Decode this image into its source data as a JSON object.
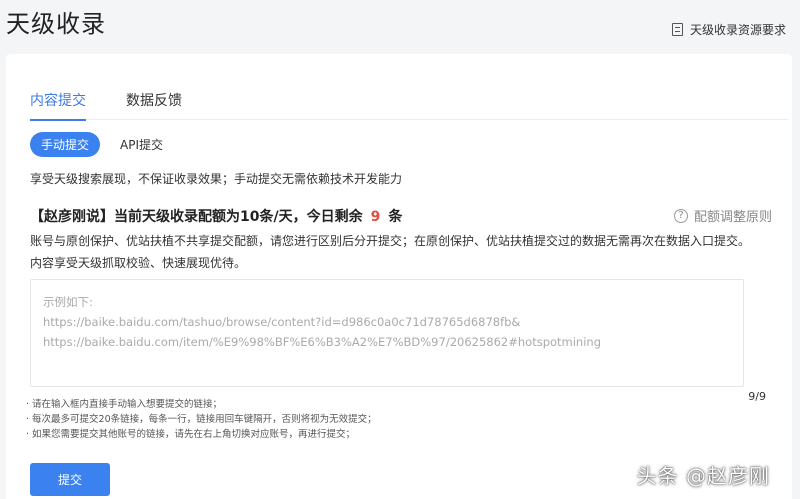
{
  "header": {
    "title": "天级收录",
    "resource_link": "天级收录资源要求"
  },
  "tabs": [
    {
      "label": "内容提交",
      "active": true
    },
    {
      "label": "数据反馈",
      "active": false
    }
  ],
  "mode": {
    "manual_label": "手动提交",
    "api_label": "API提交"
  },
  "description": "享受天级搜索展现，不保证收录效果；手动提交无需依赖技术开发能力",
  "quota": {
    "text": "【赵彦刚说】当前天级收录配额为10条/天，今日剩余",
    "remaining": "9",
    "unit": "条",
    "rule_link": "配额调整原则"
  },
  "info_line1": "账号与原创保护、优站扶植不共享提交配额，请您进行区别后分开提交；在原创保护、优站扶植提交过的数据无需再次在数据入口提交。",
  "info_line2": "内容享受天级抓取校验、快速展现优待。",
  "url_input": {
    "placeholder_title": "示例如下:",
    "example1": "https://baike.baidu.com/tashuo/browse/content?id=d986c0a0c71d78765d6878fb&",
    "example2": "https://baike.baidu.com/item/%E9%98%BF%E6%B3%A2%E7%BD%97/20625862#hotspotmining"
  },
  "counter": "9/9",
  "rules": [
    "· 请在输入框内直接手动输入想要提交的链接；",
    "· 每次最多可提交20条链接，每条一行，链接用回车键隔开，否则将视为无效提交；",
    "· 如果您需要提交其他账号的链接，请先在右上角切换对应账号，再进行提交；"
  ],
  "submit_label": "提交",
  "watermark": "头条 @赵彦刚",
  "colors": {
    "accent": "#3b82f0",
    "remaining": "#e64b3c"
  }
}
